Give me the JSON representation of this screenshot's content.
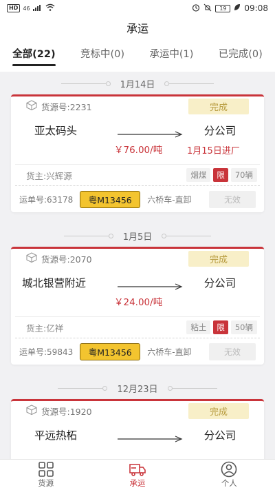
{
  "statusbar": {
    "network": "46",
    "battery": "19",
    "time": "09:08"
  },
  "title": "承运",
  "tabs": [
    {
      "label": "全部(22)",
      "active": true
    },
    {
      "label": "竞标中(0)",
      "active": false
    },
    {
      "label": "承运中(1)",
      "active": false
    },
    {
      "label": "已完成(0)",
      "active": false
    }
  ],
  "groups": [
    {
      "date": "1月14日",
      "card": {
        "source_no": "货源号:2231",
        "status": "完成",
        "from": "亚太码头",
        "to": "分公司",
        "price": "￥76.00/吨",
        "arrive": "1月15日进厂",
        "shipper": "货主:兴辉源",
        "cargo": "烟煤",
        "limit": "限",
        "vehicles": "70辆",
        "waybill": "运单号:63178",
        "plate": "粤M13456",
        "truck": "六桥车-直卸",
        "action": "无效"
      }
    },
    {
      "date": "1月5日",
      "card": {
        "source_no": "货源号:2070",
        "status": "完成",
        "from": "城北银营附近",
        "to": "分公司",
        "price": "￥24.00/吨",
        "arrive": "",
        "shipper": "货主:亿祥",
        "cargo": "粘土",
        "limit": "限",
        "vehicles": "50辆",
        "waybill": "运单号:59843",
        "plate": "粤M13456",
        "truck": "六桥车-直卸",
        "action": "无效"
      }
    },
    {
      "date": "12月23日",
      "card": {
        "source_no": "货源号:1920",
        "status": "完成",
        "from": "平远热柘",
        "to": "分公司"
      }
    }
  ],
  "bottom_nav": [
    {
      "label": "货源",
      "icon": "grid-icon",
      "active": false
    },
    {
      "label": "承运",
      "icon": "truck-icon",
      "active": true
    },
    {
      "label": "个人",
      "icon": "person-icon",
      "active": false
    }
  ],
  "colors": {
    "accent": "#c9343a",
    "plate": "#f3c42f",
    "status_bg": "#f8efc8"
  }
}
